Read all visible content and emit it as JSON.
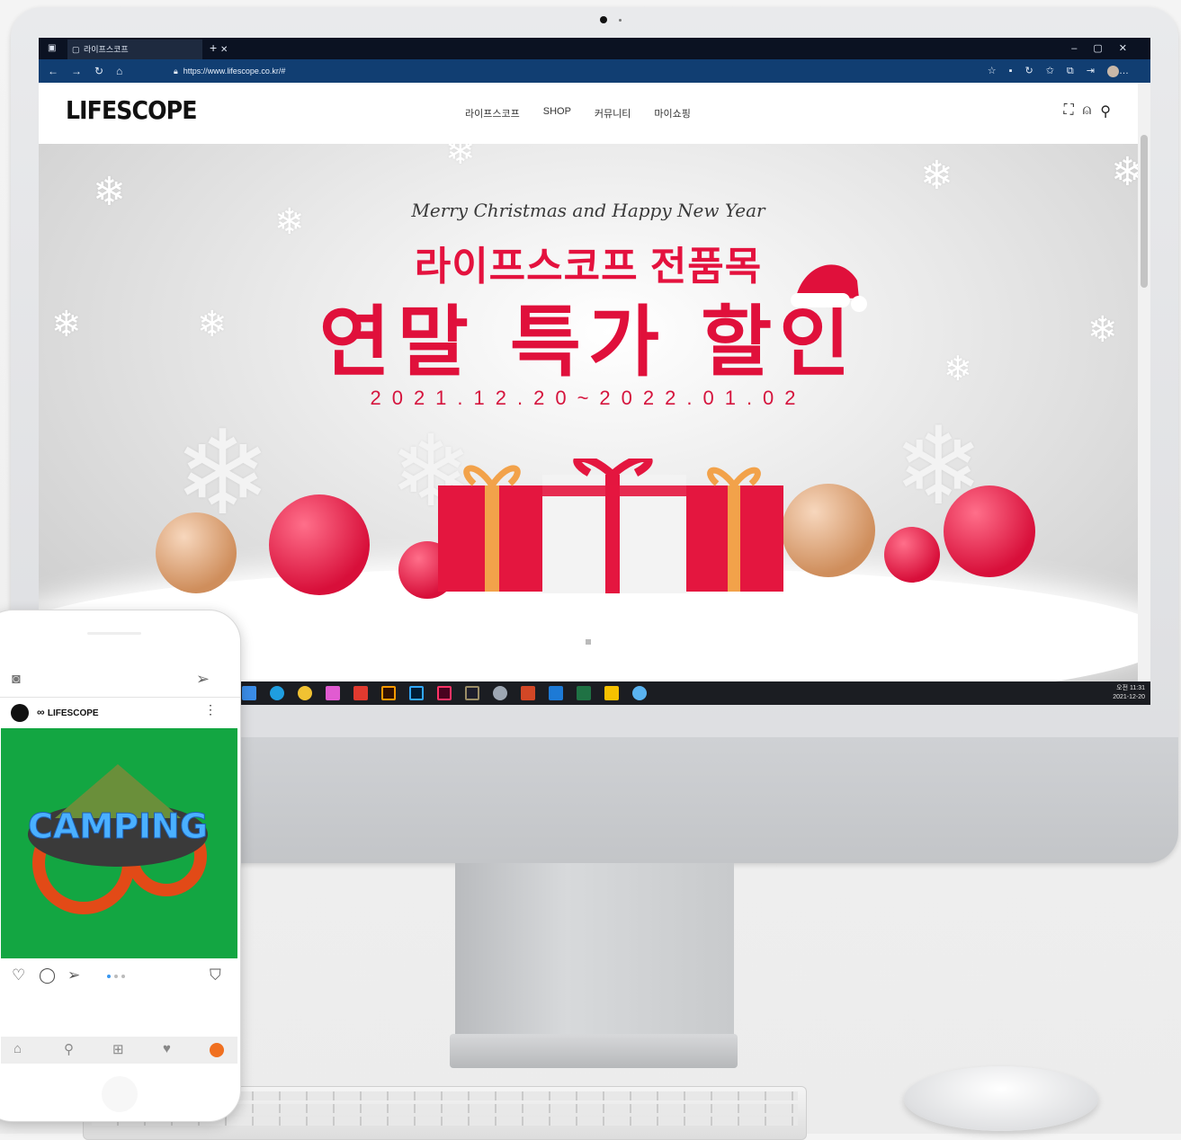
{
  "browser": {
    "tab_title": "라이프스코프",
    "url": "https://www.lifescope.co.kr/#"
  },
  "site": {
    "logo": "LIFESCOPE",
    "nav": [
      "라이프스코프",
      "SHOP",
      "커뮤니티",
      "마이쇼핑"
    ]
  },
  "hero": {
    "tagline": "Merry Christmas and Happy New Year",
    "headline": "라이프스코프 전품목",
    "title": "연말 특가 할인",
    "dates": "2021.12.20~2022.01.02"
  },
  "taskbar": {
    "time": "오전 11:31",
    "date": "2021-12-20"
  },
  "phone": {
    "account_name": "LIFESCOPE",
    "post_image_text": "CAMPING"
  },
  "colors": {
    "accent": "#e0103b",
    "post_bg": "#13a642",
    "browser_bar": "#113e72"
  }
}
